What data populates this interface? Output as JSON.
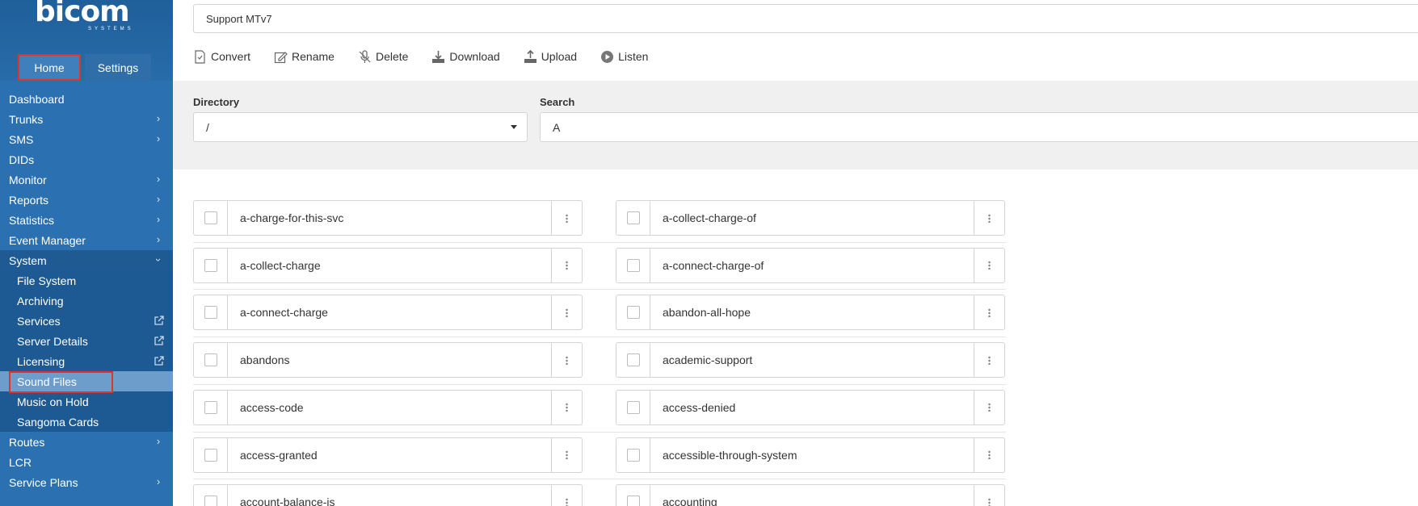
{
  "app": {
    "logo_text": "bicom",
    "logo_sub": "SYSTEMS"
  },
  "topnav": {
    "home": "Home",
    "settings": "Settings"
  },
  "sidebar": {
    "items": [
      {
        "label": "Dashboard",
        "chevron": false
      },
      {
        "label": "Trunks",
        "chevron": true
      },
      {
        "label": "SMS",
        "chevron": true
      },
      {
        "label": "DIDs",
        "chevron": false
      },
      {
        "label": "Monitor",
        "chevron": true
      },
      {
        "label": "Reports",
        "chevron": true
      },
      {
        "label": "Statistics",
        "chevron": true
      },
      {
        "label": "Event Manager",
        "chevron": true
      },
      {
        "label": "System",
        "chevron": true,
        "expanded": true
      }
    ],
    "system_sub": [
      {
        "label": "File System",
        "external": false
      },
      {
        "label": "Archiving",
        "external": false
      },
      {
        "label": "Services",
        "external": true
      },
      {
        "label": "Server Details",
        "external": true
      },
      {
        "label": "Licensing",
        "external": true
      },
      {
        "label": "Sound Files",
        "external": false,
        "selected": true
      },
      {
        "label": "Music on Hold",
        "external": false
      },
      {
        "label": "Sangoma Cards",
        "external": false
      }
    ],
    "after": [
      {
        "label": "Routes",
        "chevron": true
      },
      {
        "label": "LCR",
        "chevron": false
      },
      {
        "label": "Service Plans",
        "chevron": true
      }
    ]
  },
  "header": {
    "title": "Support MTv7"
  },
  "toolbar": {
    "convert": "Convert",
    "rename": "Rename",
    "delete": "Delete",
    "download": "Download",
    "upload": "Upload",
    "listen": "Listen"
  },
  "filters": {
    "directory_label": "Directory",
    "directory_value": "/",
    "search_label": "Search",
    "search_value": "A"
  },
  "files": {
    "left": [
      "a-charge-for-this-svc",
      "a-collect-charge",
      "a-connect-charge",
      "abandons",
      "access-code",
      "access-granted",
      "account-balance-is"
    ],
    "right": [
      "a-collect-charge-of",
      "a-connect-charge-of",
      "abandon-all-hope",
      "academic-support",
      "access-denied",
      "accessible-through-system",
      "accounting"
    ]
  },
  "colors": {
    "sidebar": "#2b71b1",
    "sidebar_selected": "#6d9dcb",
    "highlight_border": "#e0332b"
  }
}
